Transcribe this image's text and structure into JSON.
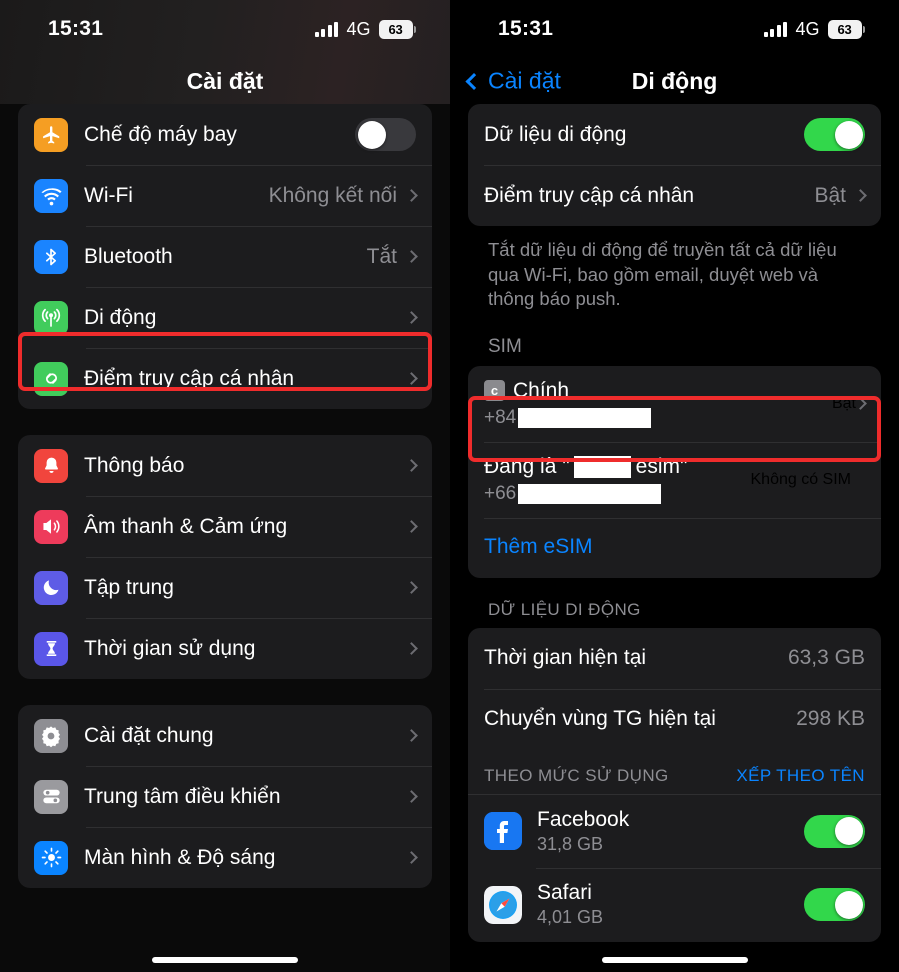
{
  "status_bar": {
    "time": "15:31",
    "network": "4G",
    "battery": "63"
  },
  "left_panel": {
    "nav_title": "Cài đặt",
    "groups": [
      {
        "items": [
          {
            "label": "Chế độ máy bay",
            "icon": "airplane-icon",
            "control": "switch",
            "switch_on": false
          },
          {
            "label": "Wi-Fi",
            "icon": "wifi-icon",
            "value": "Không kết nối",
            "control": "chevron"
          },
          {
            "label": "Bluetooth",
            "icon": "bluetooth-icon",
            "value": "Tắt",
            "control": "chevron"
          },
          {
            "label": "Di động",
            "icon": "cellular-icon",
            "value": "",
            "control": "chevron",
            "highlighted": true
          },
          {
            "label": "Điểm truy cập cá nhân",
            "icon": "hotspot-icon",
            "value": "",
            "control": "chevron"
          }
        ]
      },
      {
        "items": [
          {
            "label": "Thông báo",
            "icon": "bell-icon",
            "value": "",
            "control": "chevron"
          },
          {
            "label": "Âm thanh & Cảm ứng",
            "icon": "sound-icon",
            "value": "",
            "control": "chevron"
          },
          {
            "label": "Tập trung",
            "icon": "focus-moon-icon",
            "value": "",
            "control": "chevron"
          },
          {
            "label": "Thời gian sử dụng",
            "icon": "hourglass-icon",
            "value": "",
            "control": "chevron"
          }
        ]
      },
      {
        "items": [
          {
            "label": "Cài đặt chung",
            "icon": "gear-icon",
            "value": "",
            "control": "chevron"
          },
          {
            "label": "Trung tâm điều khiển",
            "icon": "control-center-icon",
            "value": "",
            "control": "chevron"
          },
          {
            "label": "Màn hình & Độ sáng",
            "icon": "brightness-icon",
            "value": "",
            "control": "chevron"
          }
        ]
      }
    ]
  },
  "right_panel": {
    "back_label": "Cài đặt",
    "nav_title": "Di động",
    "top_card": {
      "mobile_data_label": "Dữ liệu di động",
      "mobile_data_on": true,
      "hotspot_label": "Điểm truy cập cá nhân",
      "hotspot_value": "Bật"
    },
    "footnote": "Tắt dữ liệu di động để truyền tất cả dữ liệu qua Wi-Fi, bao gồm email, duyệt web và thông báo push.",
    "sim_section": {
      "header": "SIM",
      "rows": [
        {
          "badge": "c",
          "title": "Chính",
          "prefix": "+84",
          "redacted": true,
          "value": "Bật",
          "has_chevron": true,
          "highlighted": true
        },
        {
          "title_prefix": "Đang là \"",
          "title_suffix": " esim\"",
          "redacted_inline": true,
          "prefix": "+66",
          "redacted": true,
          "value": "Không có SIM",
          "has_chevron": false,
          "highlighted": false
        }
      ],
      "add_esim_label": "Thêm eSIM"
    },
    "data_section": {
      "header": "DỮ LIỆU DI ĐỘNG",
      "rows": [
        {
          "label": "Thời gian hiện tại",
          "value": "63,3 GB"
        },
        {
          "label": "Chuyển vùng TG hiện tại",
          "value": "298 KB"
        }
      ],
      "sort_header": "THEO MỨC SỬ DỤNG",
      "sort_link": "XẾP THEO TÊN",
      "apps": [
        {
          "name": "Facebook",
          "usage": "31,8 GB",
          "icon": "facebook-icon",
          "switch_on": true
        },
        {
          "name": "Safari",
          "usage": "4,01 GB",
          "icon": "safari-icon",
          "switch_on": true
        }
      ]
    }
  },
  "colors": {
    "accent_blue": "#0a84ff",
    "switch_green": "#32d74b",
    "highlight_red": "#ef2c2c",
    "card": "#1c1c1e",
    "secondary_text": "#8e8e93"
  }
}
